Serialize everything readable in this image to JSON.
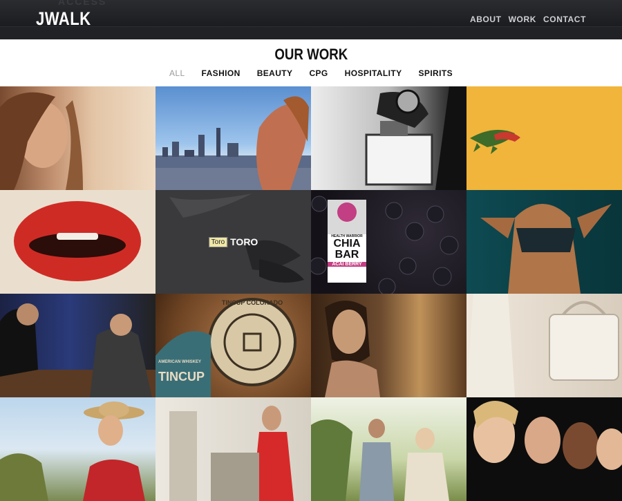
{
  "header": {
    "ghost_text": "ACCESS",
    "logo": "JWALK",
    "nav": [
      {
        "label": "ABOUT"
      },
      {
        "label": "WORK"
      },
      {
        "label": "CONTACT"
      }
    ]
  },
  "section": {
    "title": "OUR WORK",
    "filters": [
      {
        "label": "ALL",
        "active": true
      },
      {
        "label": "FASHION"
      },
      {
        "label": "BEAUTY"
      },
      {
        "label": "CPG"
      },
      {
        "label": "HOSPITALITY"
      },
      {
        "label": "SPIRITS"
      }
    ]
  },
  "tiles": {
    "t6": {
      "caption": "TORO",
      "tooltip": "Toro"
    },
    "t7": {
      "brand": "HEALTH WARRIOR",
      "line1": "CHIA",
      "line2": "BAR",
      "flavor": "ACAI BERRY"
    },
    "t10": {
      "ring_text": "TINCUP COLORADO",
      "side_text": "TINCUP",
      "sub": "AMERICAN WHISKEY"
    }
  }
}
